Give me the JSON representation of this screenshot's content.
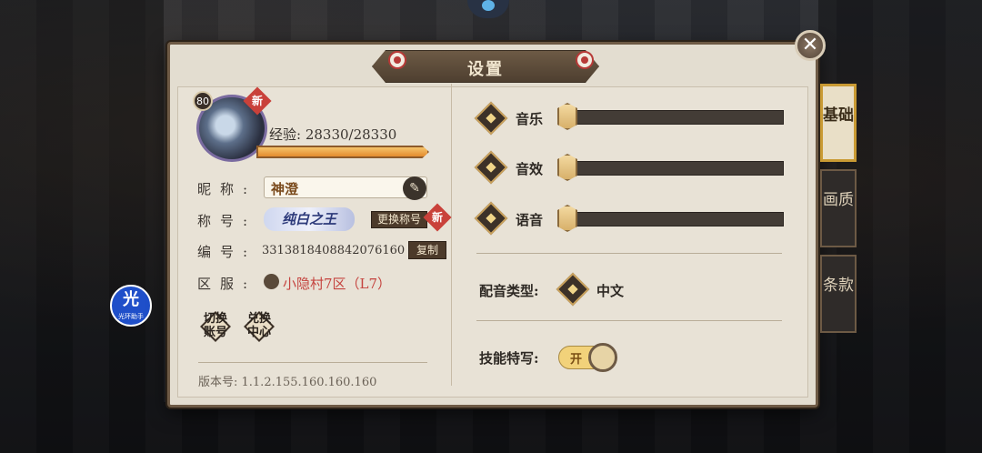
{
  "dialog": {
    "title": "设置",
    "close": "✕"
  },
  "profile": {
    "level": "80",
    "new_badge": "新",
    "exp_text": "经验: 28330/28330",
    "exp_progress": 1.0,
    "nickname_label": "昵称:",
    "nickname": "神澄",
    "title_label": "称号:",
    "title_badge": "纯白之王",
    "change_title": "更换称号",
    "id_label": "编号:",
    "id_value": "3313818408842076160",
    "copy": "复制",
    "server_label": "区服:",
    "server": "小隐村7区（L7）",
    "switch_account": "切换账号",
    "redeem_center": "兑换中心",
    "version": "版本号: 1.1.2.155.160.160.160"
  },
  "audio": [
    {
      "label": "音乐",
      "level": 0.0
    },
    {
      "label": "音效",
      "level": 0.0
    },
    {
      "label": "语音",
      "level": 0.0
    }
  ],
  "voice_type": {
    "label": "配音类型:",
    "value": "中文"
  },
  "skill_closeup": {
    "label": "技能特写:",
    "state": "开"
  },
  "side_tabs": [
    {
      "label": "基础",
      "active": true
    },
    {
      "label": "画质",
      "active": false
    },
    {
      "label": "条款",
      "active": false
    }
  ],
  "float_button": {
    "char": "光",
    "sub": "光环助手"
  }
}
